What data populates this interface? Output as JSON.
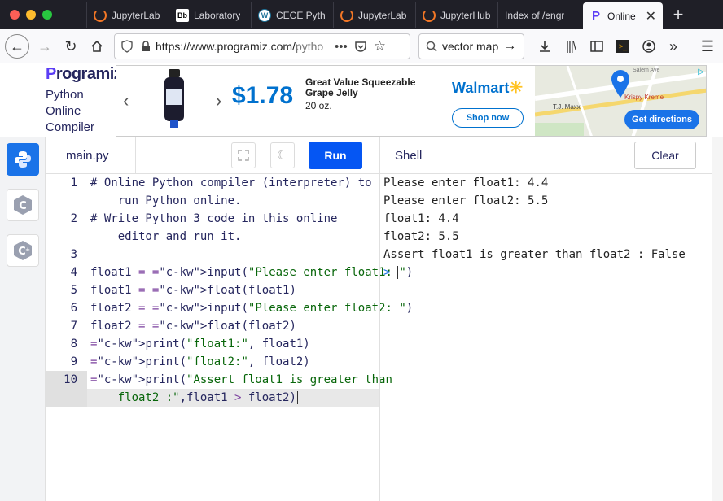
{
  "browser": {
    "tabs": [
      {
        "label": "JupyterLab",
        "icon": "jupyter-icon"
      },
      {
        "label": "Laboratory",
        "icon": "blackboard-icon"
      },
      {
        "label": "CECE Pytho",
        "icon": "wordpress-icon"
      },
      {
        "label": "JupyterLab",
        "icon": "jupyter-icon"
      },
      {
        "label": "JupyterHub",
        "icon": "jupyter-icon"
      },
      {
        "label": "Index of /engr",
        "icon": "none"
      },
      {
        "label": "Online P",
        "icon": "programiz-icon",
        "active": true
      }
    ],
    "url_main": "https://www.programiz.com/",
    "url_rest": "pytho",
    "search_text": "vector map"
  },
  "brand": {
    "logo_p": "P",
    "logo_rest": "rogramiz",
    "sub": [
      "Python",
      "Online",
      "Compiler"
    ]
  },
  "ad": {
    "price": "$1.78",
    "title": "Great Value Squeezable Grape Jelly",
    "size": "20 oz.",
    "store": "Walmart",
    "cta": "Shop now",
    "directions": "Get directions",
    "map_labels": [
      "Krispy Kreme",
      "T.J. Maxx",
      "Salem Ave"
    ]
  },
  "editor": {
    "file_name": "main.py",
    "run_label": "Run",
    "active_line": 10,
    "lines": [
      {
        "n": "1",
        "text": "# Online Python compiler (interpreter) to"
      },
      {
        "n": "",
        "text": "    run Python online."
      },
      {
        "n": "2",
        "text": "# Write Python 3 code in this online"
      },
      {
        "n": "",
        "text": "    editor and run it."
      },
      {
        "n": "3",
        "text": ""
      },
      {
        "n": "4",
        "text": "float1 = input(\"Please enter float1: \")"
      },
      {
        "n": "5",
        "text": "float1 = float(float1)"
      },
      {
        "n": "6",
        "text": "float2 = input(\"Please enter float2: \")"
      },
      {
        "n": "7",
        "text": "float2 = float(float2)"
      },
      {
        "n": "8",
        "text": "print(\"float1:\", float1)"
      },
      {
        "n": "9",
        "text": "print(\"float2:\", float2)"
      },
      {
        "n": "10",
        "text": "print(\"Assert float1 is greater than"
      },
      {
        "n": "",
        "text": "    float2 :\",float1 > float2)"
      }
    ]
  },
  "shell": {
    "title": "Shell",
    "clear_label": "Clear",
    "output": [
      "Please enter float1: 4.4",
      "Please enter float2: 5.5",
      "float1: 4.4",
      "float2: 5.5",
      "Assert float1 is greater than float2 : False"
    ],
    "prompt": ">"
  }
}
